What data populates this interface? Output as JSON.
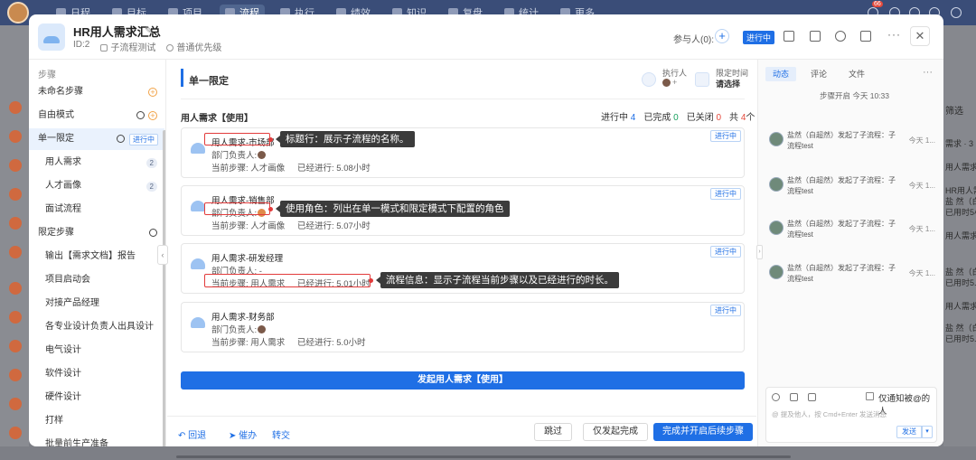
{
  "topnav": {
    "items": [
      {
        "label": "日程"
      },
      {
        "label": "目标"
      },
      {
        "label": "项目"
      },
      {
        "label": "流程"
      },
      {
        "label": "执行"
      },
      {
        "label": "绩效"
      },
      {
        "label": "知识"
      },
      {
        "label": "复盘"
      },
      {
        "label": "统计"
      },
      {
        "label": "更多"
      }
    ],
    "badge": "66"
  },
  "header": {
    "title": "HR用人需求汇总",
    "id": "ID:2",
    "subflow_test": "子流程测试",
    "priority": "普通优先级",
    "participants": "参与人(0):",
    "status": "进行中"
  },
  "steps": {
    "section_label": "步骤",
    "items": [
      {
        "label": "未命名步骤"
      },
      {
        "label": "自由模式"
      },
      {
        "label": "单一限定",
        "status": "进行中"
      },
      {
        "label": "用人需求",
        "count": "2"
      },
      {
        "label": "人才画像",
        "count": "2"
      },
      {
        "label": "面试流程"
      }
    ],
    "limited_label": "限定步骤",
    "limited_items": [
      {
        "label": "输出【需求文档】报告"
      },
      {
        "label": "项目启动会"
      },
      {
        "label": "对接产品经理"
      },
      {
        "label": "各专业设计负责人出具设计"
      },
      {
        "label": "电气设计"
      },
      {
        "label": "软件设计"
      },
      {
        "label": "硬件设计"
      },
      {
        "label": "打样"
      },
      {
        "label": "批量前生产准备"
      }
    ]
  },
  "main": {
    "step_title": "单一限定",
    "executor_label": "执行人",
    "executor_plus": "+",
    "deadline_label": "限定时间",
    "deadline_value": "请选择",
    "section_title": "用人需求【使用】",
    "stats": {
      "in_progress_label": "进行中",
      "in_progress": "4",
      "done_label": "已完成",
      "done": "0",
      "closed_label": "已关闭",
      "closed": "0",
      "total_label": "共",
      "total": "4",
      "total_unit": "个"
    },
    "cards": [
      {
        "name": "用人需求-市场部",
        "owner": "部门负责人:",
        "current": "当前步骤: 人才画像",
        "elapsed": "已经进行: 5.08小时",
        "tag": "进行中"
      },
      {
        "name": "用人需求-销售部",
        "owner": "部门负责人:",
        "current": "当前步骤: 人才画像",
        "elapsed": "已经进行: 5.07小时",
        "tag": "进行中"
      },
      {
        "name": "用人需求-研发经理",
        "owner": "部门负责人: -",
        "current": "当前步骤: 用人需求",
        "elapsed": "已经进行: 5.01小时",
        "tag": "进行中"
      },
      {
        "name": "用人需求-财务部",
        "owner": "部门负责人:",
        "current": "当前步骤: 用人需求",
        "elapsed": "已经进行: 5.0小时",
        "tag": "进行中"
      }
    ],
    "callouts": {
      "title_row": "标题行：展示子流程的名称。",
      "role": "使用角色：列出在单一模式和限定模式下配置的角色",
      "flow_info": "流程信息：显示子流程当前步骤以及已经进行的时长。"
    },
    "start_button": "发起用人需求【使用】"
  },
  "footer": {
    "return": "回退",
    "remind": "催办",
    "transfer": "转交",
    "skip": "跳过",
    "only_start_done": "仅发起完成",
    "complete_next": "完成并开启后续步骤"
  },
  "rpanel": {
    "tabs": [
      {
        "label": "动态"
      },
      {
        "label": "评论"
      },
      {
        "label": "文件"
      }
    ],
    "more": "···",
    "system_message": "步骤开启 今天 10:33",
    "activities": [
      {
        "text": "盐然（白超然）发起了子流程：子流程test",
        "time": "今天 1..."
      },
      {
        "text": "盐然（白超然）发起了子流程：子流程test",
        "time": "今天 1..."
      },
      {
        "text": "盐然（白超然）发起了子流程：子流程test",
        "time": "今天 1..."
      },
      {
        "text": "盐然（白超然）发起了子流程：子流程test",
        "time": "今天 1..."
      }
    ],
    "only_notify": "仅通知被@的人",
    "hint": "@ 提及他人，按 Cmd+Enter 发送消息",
    "send": "发送"
  },
  "background": {
    "filter": "筛选",
    "fragments": [
      "需求 · 3",
      "用人需求-财",
      "HR用人需求",
      "盐 然（白...",
      "已用时5小",
      "用人需求-研",
      "盐 然（白...",
      "已用时5.01",
      "用人需求-",
      "盐 然（白...",
      "已用时5.33"
    ]
  }
}
